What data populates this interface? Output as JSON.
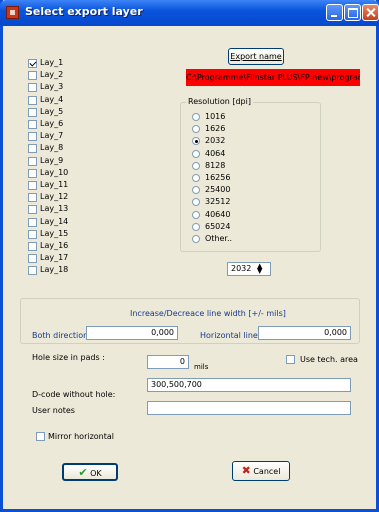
{
  "window": {
    "title": "Select export layer"
  },
  "layers": [
    {
      "label": "Lay_1",
      "checked": true
    },
    {
      "label": "Lay_2",
      "checked": false
    },
    {
      "label": "Lay_3",
      "checked": false
    },
    {
      "label": "Lay_4",
      "checked": false
    },
    {
      "label": "Lay_5",
      "checked": false
    },
    {
      "label": "Lay_6",
      "checked": false
    },
    {
      "label": "Lay_7",
      "checked": false
    },
    {
      "label": "Lay_8",
      "checked": false
    },
    {
      "label": "Lay_9",
      "checked": false
    },
    {
      "label": "Lay_10",
      "checked": false
    },
    {
      "label": "Lay_11",
      "checked": false
    },
    {
      "label": "Lay_12",
      "checked": false
    },
    {
      "label": "Lay_13",
      "checked": false
    },
    {
      "label": "Lay_14",
      "checked": false
    },
    {
      "label": "Lay_15",
      "checked": false
    },
    {
      "label": "Lay_16",
      "checked": false
    },
    {
      "label": "Lay_17",
      "checked": false
    },
    {
      "label": "Lay_18",
      "checked": false
    }
  ],
  "export": {
    "button_label": "Export name",
    "path": "C:\\Programme\\Filnstar PLUS\\FP new\\programs\\T"
  },
  "resolution": {
    "title": "Resolution [dpi]",
    "options": [
      "1016",
      "1626",
      "2032",
      "4064",
      "8128",
      "16256",
      "25400",
      "32512",
      "40640",
      "65024",
      "Other.."
    ],
    "selected": "2032",
    "spin_value": "2032"
  },
  "linewidth": {
    "title": "Increase/Decreace line width  [+/- mils]",
    "both_label": "Both direction",
    "both_value": "0,000",
    "horizontal_label": "Horizontal line",
    "horizontal_value": "0,000"
  },
  "hole": {
    "label": "Hole size in  pads :",
    "value": "0",
    "unit": "mils"
  },
  "use_tech": {
    "label": "Use tech. area",
    "checked": false
  },
  "dcode": {
    "label": "D-code without  hole:",
    "value": "300,500,700"
  },
  "notes": {
    "label": "User notes",
    "value": ""
  },
  "mirror": {
    "label": "Mirror horizontal",
    "checked": false
  },
  "buttons": {
    "ok": "OK",
    "cancel": "Cancel"
  },
  "colors": {
    "title_bar": "#0a55dd",
    "path_bg": "#ff0000",
    "dialog_bg": "#ece9d8"
  }
}
